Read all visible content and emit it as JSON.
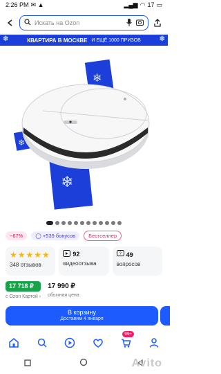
{
  "status": {
    "time": "2:26 PM",
    "battery": "17"
  },
  "search": {
    "placeholder": "Искать на Ozon"
  },
  "banner": {
    "title": "КВАРТИРА В МОСКВЕ",
    "subtitle": "И ЕЩЁ 1000 ПРИЗОВ"
  },
  "carousel": {
    "count": 12,
    "active": 0
  },
  "badges": {
    "discount": "−67%",
    "bonus": "+539 бонусов",
    "bestseller": "Бестселлер"
  },
  "stats": {
    "rating_stars": "★★★★★",
    "reviews_count": "348 отзывов",
    "video_count": "92",
    "video_label": "видеоотзыва",
    "questions_count": "49",
    "questions_label": "вопросов"
  },
  "prices": {
    "card_price": "17 718 ₽",
    "card_caption": "с Ozon Картой",
    "regular_price": "17 990 ₽",
    "regular_caption": "обычная цена"
  },
  "cart": {
    "label": "В корзину",
    "delivery": "Доставим 4 января"
  },
  "nav": {
    "cart_badge": "99+"
  },
  "watermark": "Avito",
  "colors": {
    "accent": "#1d5bff",
    "banner": "#1b3fd8",
    "green": "#16a34a",
    "pink": "#e91e63"
  }
}
